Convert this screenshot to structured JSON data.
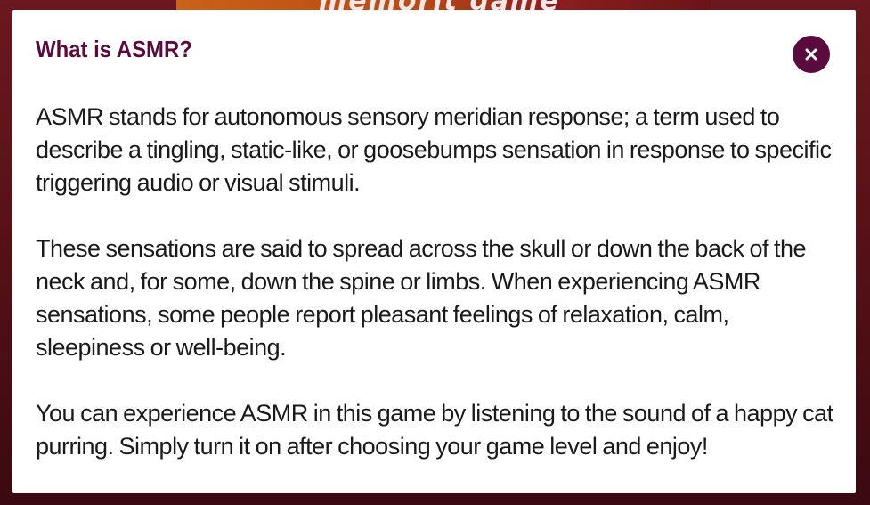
{
  "background": {
    "banner_text": "memorit game"
  },
  "modal": {
    "title": "What is ASMR?",
    "close_label": "×",
    "paragraphs": [
      "ASMR stands for autonomous sensory meridian response; a term used to describe a tingling, static-like, or goosebumps sensation in response to specific triggering audio or visual stimuli.",
      "These sensations are said to spread across the skull or down the back of the neck and, for some, down the spine or limbs. When experiencing ASMR sensations, some people report pleasant feelings of relaxation, calm, sleepiness or well-being.",
      "You can experience ASMR in this game by listening to the sound of a happy cat purring. Simply turn it on after choosing your game level and enjoy!"
    ]
  },
  "colors": {
    "accent": "#5a0a3c",
    "backdrop": "#5a1219",
    "text": "#1a1a1a"
  }
}
